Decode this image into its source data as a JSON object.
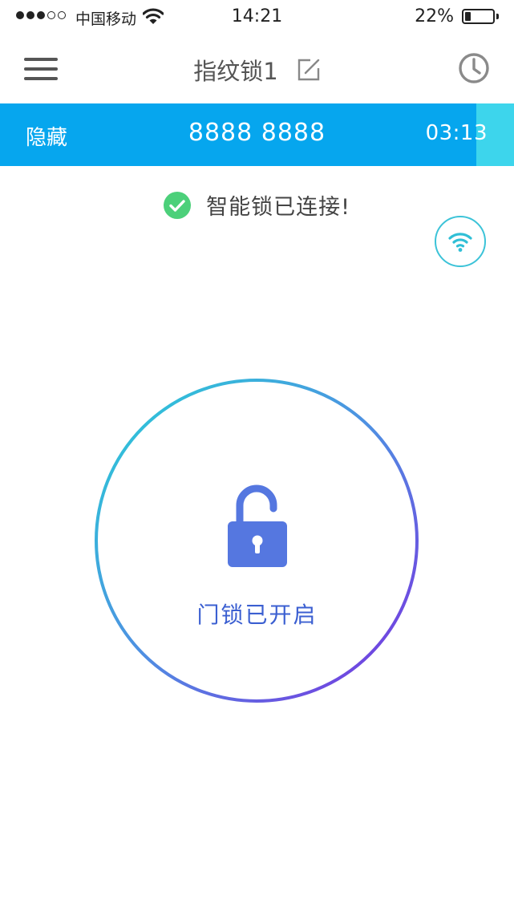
{
  "status_bar": {
    "signal_filled": 3,
    "signal_total": 5,
    "carrier": "中国移动",
    "time": "14:21",
    "battery_percent": "22%",
    "battery_level": 0.22
  },
  "header": {
    "title": "指纹锁1",
    "menu_icon": "hamburger-menu-icon",
    "edit_icon": "edit-icon",
    "history_icon": "clock-icon"
  },
  "password_bar": {
    "hide_label": "隐藏",
    "password": "8888 8888",
    "countdown": "03:13",
    "background_color": "#06a6ee",
    "accent_color": "#3dd5ec"
  },
  "connection": {
    "status_text": "智能锁已连接!",
    "status_color": "#4cd07a",
    "wifi_icon": "wifi-icon"
  },
  "lock": {
    "status_text": "门锁已开启",
    "icon": "unlocked-padlock-icon",
    "gradient_start": "#27cfd6",
    "gradient_end": "#7b2de0",
    "icon_color": "#5577e0"
  }
}
